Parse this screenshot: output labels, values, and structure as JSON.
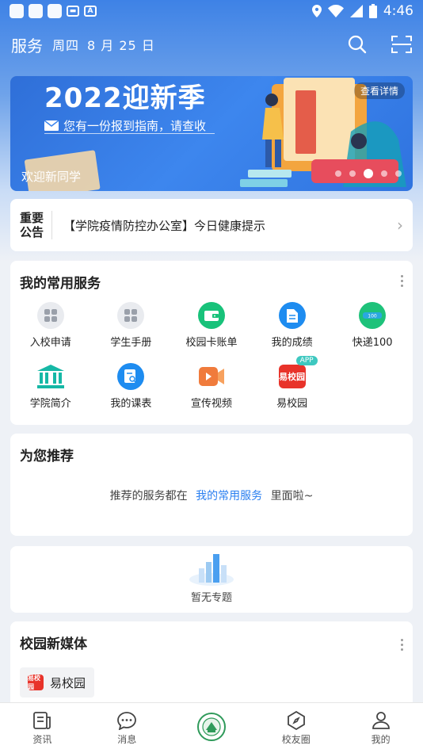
{
  "status_bar": {
    "time": "4:46"
  },
  "header": {
    "title": "服务",
    "weekday": "周四",
    "date": "8 月 25 日"
  },
  "banner": {
    "title": "2022迎新季",
    "subtitle": "您有一份报到指南，请查收",
    "welcome": "欢迎新同学",
    "detail_button": "查看详情",
    "dots_total": 5,
    "dots_active_index": 2
  },
  "notice": {
    "tag_line1": "重要",
    "tag_line2": "公告",
    "text": "【学院疫情防控办公室】今日健康提示"
  },
  "services": {
    "title": "我的常用服务",
    "items": [
      {
        "label": "入校申请",
        "icon": "grid-icon",
        "color": "#e9ebef"
      },
      {
        "label": "学生手册",
        "icon": "grid-icon",
        "color": "#e9ebef"
      },
      {
        "label": "校园卡账单",
        "icon": "wallet-icon",
        "color": "#18c27a"
      },
      {
        "label": "我的成绩",
        "icon": "document-icon",
        "color": "#1e8cf0"
      },
      {
        "label": "快递100",
        "icon": "express-icon",
        "color": "#1ec27a"
      },
      {
        "label": "学院简介",
        "icon": "building-icon",
        "color": "#16b8a6"
      },
      {
        "label": "我的课表",
        "icon": "schedule-icon",
        "color": "#1e8cf0"
      },
      {
        "label": "宣传视频",
        "icon": "video-icon",
        "color": "#f07b3c"
      },
      {
        "label": "易校园",
        "icon": "app-logo-icon",
        "color": "#e8332a",
        "badge": "APP",
        "logo_text": "易校园"
      }
    ]
  },
  "recommend": {
    "title": "为您推荐",
    "text_before": "推荐的服务都在",
    "link": "我的常用服务",
    "text_after": "里面啦~"
  },
  "topics": {
    "empty_text": "暂无专题"
  },
  "media": {
    "title": "校园新媒体",
    "chip_label": "易校园",
    "chip_logo_text": "易校园"
  },
  "tabs": [
    {
      "label": "资讯",
      "icon": "news-icon"
    },
    {
      "label": "消息",
      "icon": "chat-icon"
    },
    {
      "label": "",
      "icon": "school-logo-icon"
    },
    {
      "label": "校友圈",
      "icon": "compass-icon"
    },
    {
      "label": "我的",
      "icon": "person-icon"
    }
  ]
}
